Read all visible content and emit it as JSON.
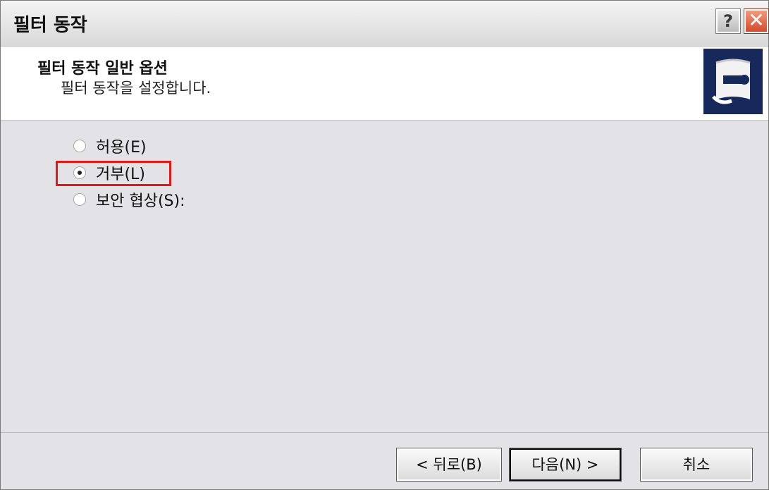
{
  "window": {
    "title": "필터 동작",
    "help_label": "?",
    "close_label": "✕"
  },
  "header": {
    "title": "필터 동작 일반 옵션",
    "subtitle": "필터 동작을 설정합니다."
  },
  "options": [
    {
      "label": "허용(E)",
      "checked": false
    },
    {
      "label": "거부(L)",
      "checked": true
    },
    {
      "label": "보안 협상(S):",
      "checked": false
    }
  ],
  "buttons": {
    "back": "< 뒤로(B)",
    "next": "다음(N) >",
    "cancel": "취소"
  },
  "colors": {
    "highlight": "#e01818",
    "logo_bg": "#17285a"
  }
}
